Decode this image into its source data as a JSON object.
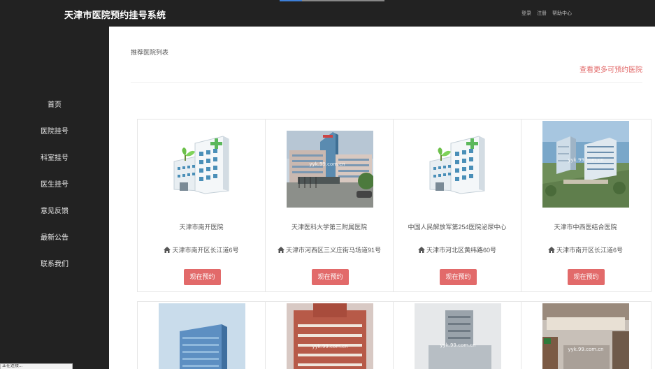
{
  "header": {
    "brand": "天津市医院预约挂号系统",
    "links": [
      "登录",
      "注册",
      "帮助中心"
    ]
  },
  "sidebar": {
    "items": [
      {
        "label": "首页"
      },
      {
        "label": "医院挂号"
      },
      {
        "label": "科室挂号"
      },
      {
        "label": "医生挂号"
      },
      {
        "label": "意见反馈"
      },
      {
        "label": "最新公告"
      },
      {
        "label": "联系我们"
      }
    ]
  },
  "status_bar": {
    "text": "正在连接..."
  },
  "main": {
    "section_title": "推荐医院列表",
    "more_link": "查看更多可预约医院",
    "hospitals": [
      {
        "name": "天津市南开医院",
        "address": "天津市南开区长江道6号",
        "button": "现在预约",
        "image": "hospital-building-icon",
        "watermark": ""
      },
      {
        "name": "天津医科大学第三附属医院",
        "address": "天津市河西区三义庄街马场道91号",
        "button": "现在预约",
        "image": "hospital-photo",
        "watermark": "yyk.99.com.cn"
      },
      {
        "name": "中国人民解放军第254医院泌尿中心",
        "address": "天津市河北区黄纬路60号",
        "button": "现在预约",
        "image": "hospital-building-icon",
        "watermark": ""
      },
      {
        "name": "天津市中西医结合医院",
        "address": "天津市南开区长江道6号",
        "button": "现在预约",
        "image": "hospital-aerial-photo",
        "watermark": "yyk.99.com.cn"
      }
    ],
    "second_row": [
      {
        "image": "hospital-tower-photo",
        "watermark": ""
      },
      {
        "image": "hospital-brick-photo",
        "watermark": "yyk.99.com.cn"
      },
      {
        "image": "hospital-gray-tower-photo",
        "watermark": "yyk.99.com.cn"
      },
      {
        "image": "hospital-gate-photo",
        "watermark": "yyk.99.com.cn"
      }
    ]
  },
  "colors": {
    "topbar": "#222222",
    "accent": "#e26a6a",
    "text": "#555555"
  }
}
